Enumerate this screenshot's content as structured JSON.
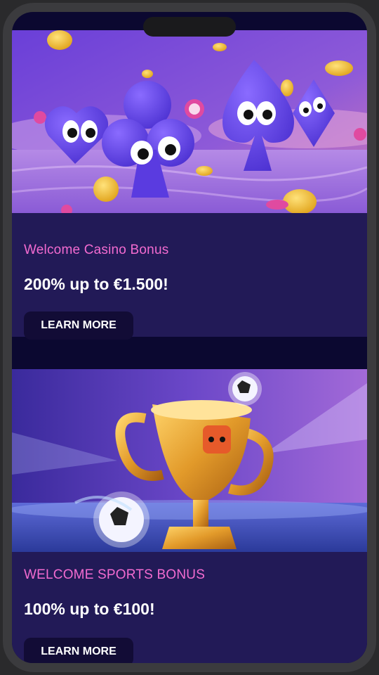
{
  "cards": [
    {
      "title": "Welcome Casino Bonus",
      "amount": "200% up to €1.500!",
      "button_label": "LEARN MORE",
      "banner_icon": "casino-card-suits-illustration"
    },
    {
      "title": "WELCOME SPORTS BONUS",
      "amount": "100% up to €100!",
      "button_label": "LEARN MORE",
      "banner_icon": "trophy-football-illustration"
    }
  ],
  "colors": {
    "title_accent": "#f36bd0",
    "card_background": "#221a57",
    "button_background": "#120c36",
    "screen_background": "#0b0830"
  }
}
